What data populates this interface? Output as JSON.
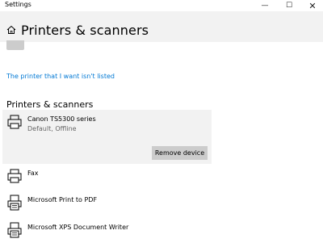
{
  "window": {
    "title": "Settings",
    "minimize_glyph": "—",
    "maximize_glyph": "☐",
    "close_glyph": "✕"
  },
  "header": {
    "title": "Printers & scanners",
    "home_icon": "home-icon"
  },
  "links": {
    "printer_not_listed": "The printer that I want isn't listed"
  },
  "section": {
    "title": "Printers & scanners"
  },
  "devices": [
    {
      "name": "Canon TS5300 series",
      "status": "Default, Offline",
      "icon": "printer-icon",
      "selected": true
    },
    {
      "name": "Fax",
      "status": "",
      "icon": "printer-icon",
      "selected": false
    },
    {
      "name": "Microsoft Print to PDF",
      "status": "",
      "icon": "printer-doc-icon",
      "selected": false
    },
    {
      "name": "Microsoft XPS Document Writer",
      "status": "",
      "icon": "printer-doc-icon",
      "selected": false
    }
  ],
  "buttons": {
    "remove_device": "Remove device"
  },
  "colors": {
    "accent_link": "#0078d4",
    "header_bg": "#f2f2f2",
    "selected_bg": "#f2f2f2",
    "button_bg": "#cccccc"
  }
}
